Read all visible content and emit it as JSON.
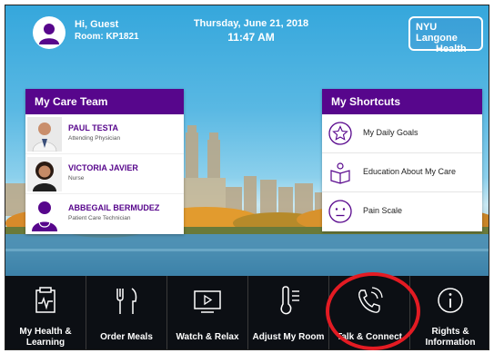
{
  "header": {
    "greeting": "Hi, Guest",
    "room": "Room: KP1821",
    "date": "Thursday, June 21, 2018",
    "time": "11:47 AM",
    "logo_line1": "NYU Langone",
    "logo_line2": "Health"
  },
  "care_team": {
    "title": "My Care Team",
    "members": [
      {
        "name": "PAUL TESTA",
        "role": "Attending Physician"
      },
      {
        "name": "VICTORIA JAVIER",
        "role": "Nurse"
      },
      {
        "name": "ABBEGAIL BERMUDEZ",
        "role": "Patient Care Technician"
      }
    ]
  },
  "shortcuts": {
    "title": "My Shortcuts",
    "items": [
      {
        "label": "My Daily Goals",
        "icon": "star-icon"
      },
      {
        "label": "Education About My Care",
        "icon": "book-icon"
      },
      {
        "label": "Pain Scale",
        "icon": "face-icon"
      }
    ]
  },
  "nav": {
    "items": [
      {
        "line1": "My Health &",
        "line2": "Learning",
        "icon": "health-chart-icon"
      },
      {
        "line1": "Order Meals",
        "line2": "",
        "icon": "utensils-icon"
      },
      {
        "line1": "Watch & Relax",
        "line2": "",
        "icon": "tv-play-icon"
      },
      {
        "line1": "Adjust My Room",
        "line2": "",
        "icon": "thermometer-icon"
      },
      {
        "line1": "Talk & Connect",
        "line2": "",
        "icon": "phone-call-icon"
      },
      {
        "line1": "Rights &",
        "line2": "Information",
        "icon": "info-icon"
      }
    ]
  },
  "colors": {
    "brand_purple": "#57068c",
    "nav_background": "#0c0f14",
    "highlight_red": "#e31b23"
  }
}
